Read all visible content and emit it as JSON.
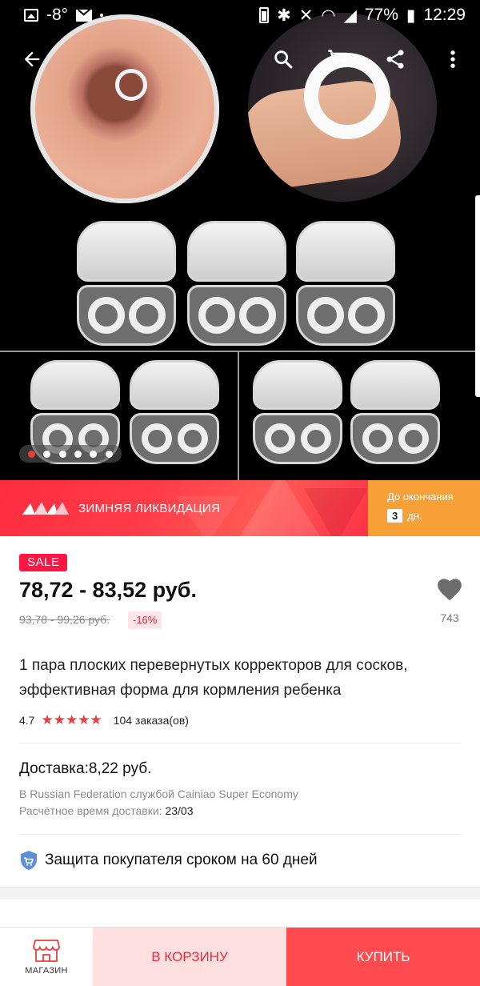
{
  "status_bar": {
    "temperature": "-8°",
    "battery": "77%",
    "time": "12:29"
  },
  "gallery": {
    "slide_count": 6,
    "active_slide": 1
  },
  "promo": {
    "title": "ЗИМНЯЯ ЛИКВИДАЦИЯ",
    "until_label": "До окончания",
    "days_value": "3",
    "days_unit": "дн."
  },
  "product": {
    "sale_badge": "SALE",
    "price": "78,72 - 83,52 руб.",
    "old_price": "93,78 - 99,26 руб.",
    "discount": "-16%",
    "wishlist_count": "743",
    "title": "1 пара плоских перевернутых корректоров для сосков, эффективная форма для кормления ребенка",
    "rating": "4.7",
    "stars": "★★★★★",
    "orders": "104 заказа(ов)"
  },
  "delivery": {
    "title": "Доставка:8,22 руб.",
    "service": "В Russian Federation службой Cainiao Super Economy",
    "eta_label": "Расчётное время доставки:",
    "eta_value": "23/03"
  },
  "protection": {
    "text": "Защита покупателя сроком на 60 дней"
  },
  "bottom_bar": {
    "store_label": "МАГАЗИН",
    "cart_label": "В КОРЗИНУ",
    "buy_label": "КУПИТЬ"
  },
  "colors": {
    "accent": "#ff4a4f",
    "promo_red": "#ff2c3f",
    "promo_orange": "#f7a035",
    "sale_red": "#ff1744",
    "star_red": "#ef3c3c"
  }
}
